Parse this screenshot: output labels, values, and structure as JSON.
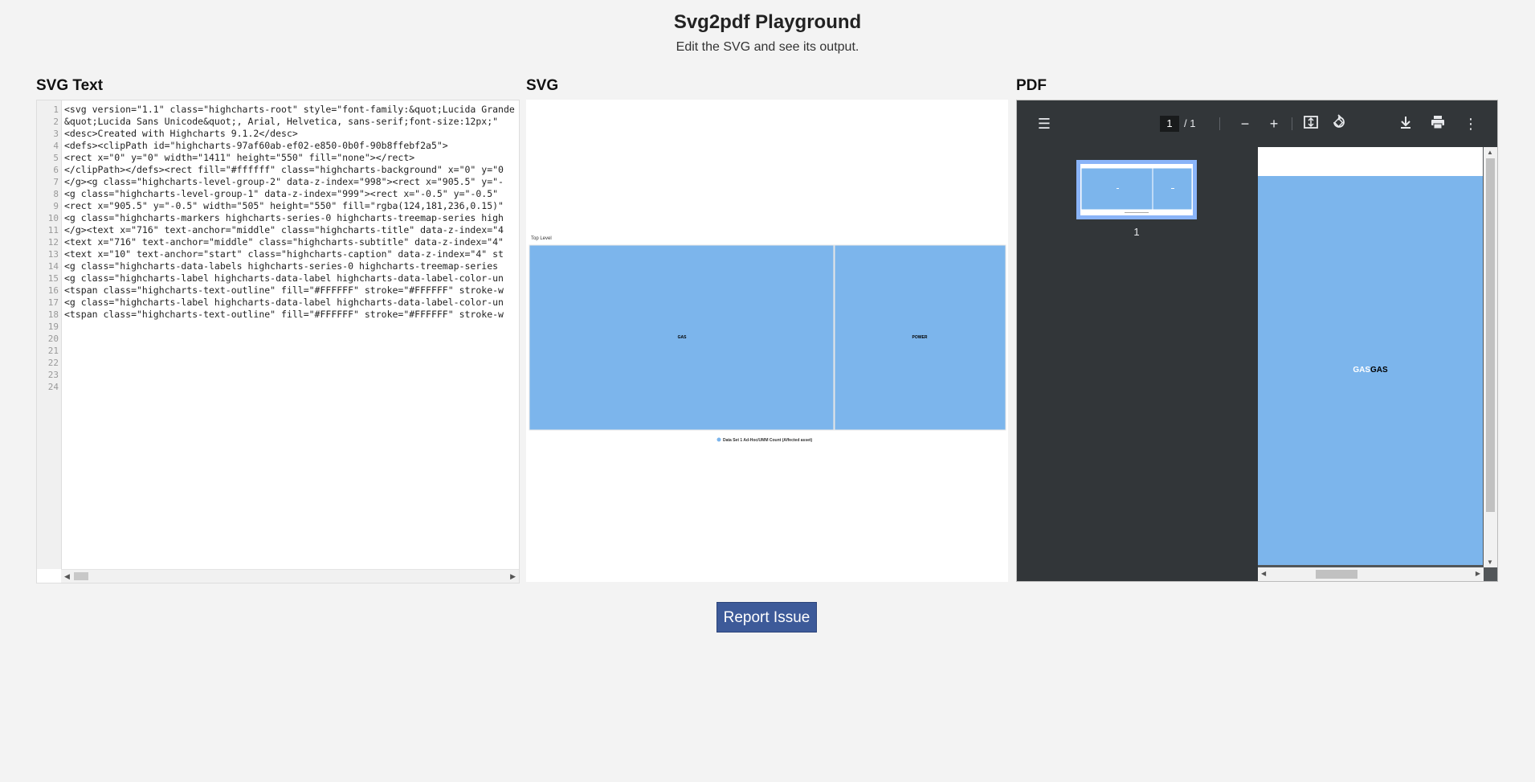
{
  "header": {
    "title": "Svg2pdf Playground",
    "subtitle": "Edit the SVG and see its output."
  },
  "columns": {
    "svg_text": "SVG Text",
    "svg": "SVG",
    "pdf": "PDF"
  },
  "editor": {
    "line_numbers": [
      "1",
      "2",
      "3",
      "4",
      "5",
      "6",
      "7",
      "8",
      "9",
      "10",
      "11",
      "12",
      "13",
      "14",
      "15",
      "16",
      "17",
      "18",
      "19",
      "20",
      "21",
      "22",
      "23",
      "24"
    ],
    "lines": [
      "<svg version=\"1.1\" class=\"highcharts-root\" style=\"font-family:&quot;Lucida Grande",
      "&quot;Lucida Sans Unicode&quot;, Arial, Helvetica, sans-serif;font-size:12px;\"",
      "<desc>Created with Highcharts 9.1.2</desc>",
      "<defs><clipPath id=\"highcharts-97af60ab-ef02-e850-0b0f-90b8ffebf2a5\">",
      "<rect x=\"0\" y=\"0\" width=\"1411\" height=\"550\" fill=\"none\"></rect>",
      "</clipPath></defs><rect fill=\"#ffffff\" class=\"highcharts-background\" x=\"0\" y=\"0",
      "</g><g class=\"highcharts-level-group-2\" data-z-index=\"998\"><rect x=\"905.5\" y=\"-",
      "<g class=\"highcharts-level-group-1\" data-z-index=\"999\"><rect x=\"-0.5\" y=\"-0.5\"",
      "<rect x=\"905.5\" y=\"-0.5\" width=\"505\" height=\"550\" fill=\"rgba(124,181,236,0.15)\"",
      "<g class=\"highcharts-markers highcharts-series-0 highcharts-treemap-series high",
      "</g><text x=\"716\" text-anchor=\"middle\" class=\"highcharts-title\" data-z-index=\"4",
      "<text x=\"716\" text-anchor=\"middle\" class=\"highcharts-subtitle\" data-z-index=\"4\"",
      "<text x=\"10\" text-anchor=\"start\" class=\"highcharts-caption\" data-z-index=\"4\" st",
      "<g class=\"highcharts-data-labels highcharts-series-0 highcharts-treemap-series",
      "<g class=\"highcharts-label highcharts-data-label highcharts-data-label-color-un",
      "<tspan class=\"highcharts-text-outline\" fill=\"#FFFFFF\" stroke=\"#FFFFFF\" stroke-w",
      "<g class=\"highcharts-label highcharts-data-label highcharts-data-label-color-un",
      "<tspan class=\"highcharts-text-outline\" fill=\"#FFFFFF\" stroke=\"#FFFFFF\" stroke-w"
    ]
  },
  "svg_preview": {
    "breadcrumb": "Top Level",
    "cell_left": "GAS",
    "cell_right": "POWER",
    "legend": "Data Set 1 Ad-Hoc/UMM Count (Affected asset)",
    "fill": "#7cb5ec"
  },
  "pdf_viewer": {
    "page_current": "1",
    "page_total": "/ 1",
    "thumb_number": "1",
    "page_text": "GASGAS",
    "icons": [
      "menu-icon",
      "zoom-out-icon",
      "zoom-in-icon",
      "fit-page-icon",
      "rotate-icon",
      "download-icon",
      "print-icon",
      "more-icon"
    ]
  },
  "footer": {
    "report_button": "Report Issue"
  },
  "colors": {
    "accent": "#3d5a99",
    "chart_blue": "#7cb5ec",
    "pdf_toolbar": "#323639"
  }
}
